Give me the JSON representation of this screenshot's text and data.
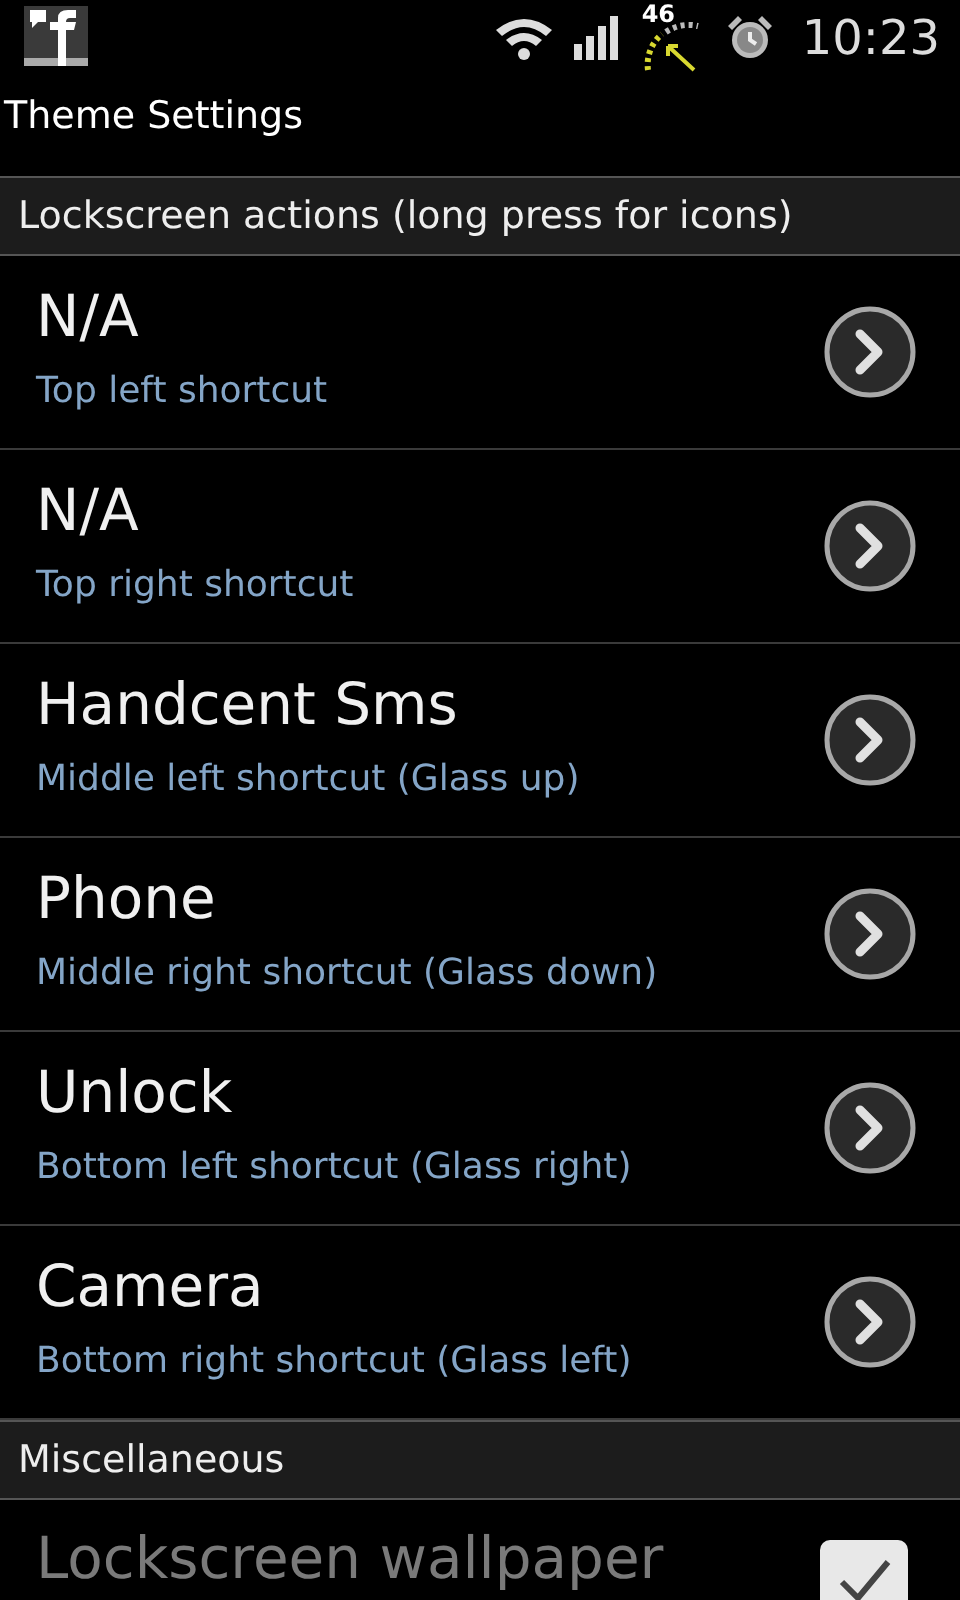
{
  "status_bar": {
    "speed_reading": "46",
    "time": "10:23"
  },
  "title": "Theme Settings",
  "sections": [
    {
      "header": "Lockscreen actions (long press for icons)",
      "items": [
        {
          "kind": "link",
          "title": "N/A",
          "summary": "Top left shortcut"
        },
        {
          "kind": "link",
          "title": "N/A",
          "summary": "Top right shortcut"
        },
        {
          "kind": "link",
          "title": "Handcent Sms",
          "summary": "Middle left shortcut (Glass up)"
        },
        {
          "kind": "link",
          "title": "Phone",
          "summary": "Middle right shortcut (Glass down)"
        },
        {
          "kind": "link",
          "title": "Unlock",
          "summary": "Bottom left shortcut (Glass right)"
        },
        {
          "kind": "link",
          "title": "Camera",
          "summary": "Bottom right shortcut (Glass left)"
        }
      ]
    },
    {
      "header": "Miscellaneous",
      "items": [
        {
          "kind": "checkbox",
          "title": "Lockscreen wallpaper",
          "checked": true
        }
      ]
    }
  ]
}
